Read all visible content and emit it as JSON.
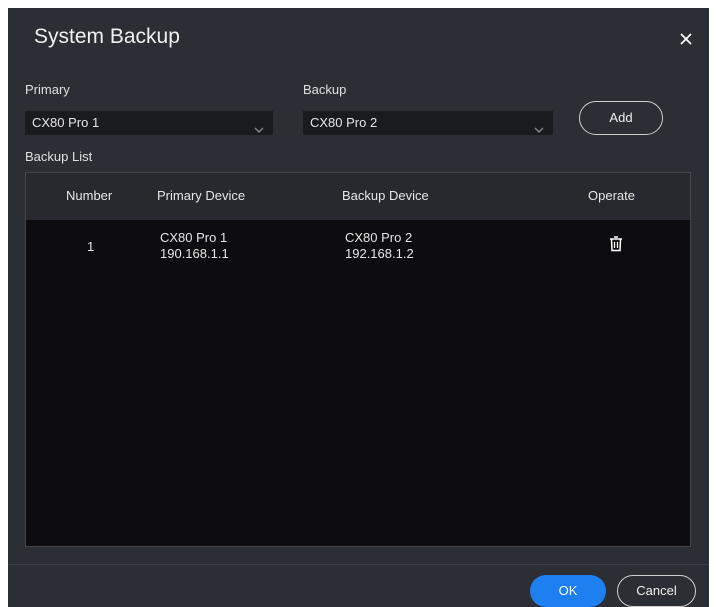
{
  "dialog": {
    "title": "System Backup",
    "close_icon": "close-icon"
  },
  "form": {
    "primary_label": "Primary",
    "primary_value": "CX80 Pro 1",
    "backup_label": "Backup",
    "backup_value": "CX80 Pro 2",
    "add_label": "Add",
    "chevron_icon": "chevron-down-icon"
  },
  "backup_list": {
    "label": "Backup List",
    "columns": [
      "Number",
      "Primary Device",
      "Backup Device",
      "Operate"
    ],
    "rows": [
      {
        "number": "1",
        "primary_name": "CX80 Pro 1",
        "primary_ip": "190.168.1.1",
        "backup_name": "CX80 Pro 2",
        "backup_ip": "192.168.1.2",
        "operate_icon": "trash-icon"
      }
    ]
  },
  "footer": {
    "ok_label": "OK",
    "cancel_label": "Cancel"
  },
  "colors": {
    "dialog_bg": "#2c2e35",
    "table_bg": "#0d0d0f",
    "header_bg": "#28292e",
    "accent": "#1e7ff0"
  }
}
